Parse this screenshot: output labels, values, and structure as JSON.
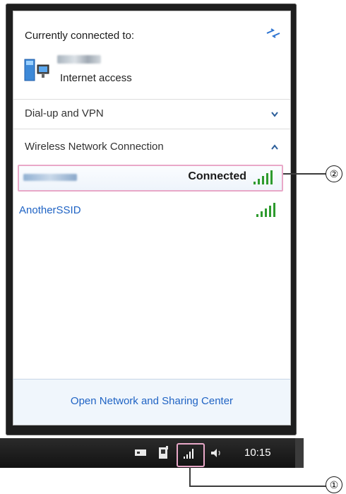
{
  "flyout": {
    "header": {
      "title": "Currently connected to:",
      "network_status": "Internet access"
    },
    "sections": [
      {
        "label": "Dial-up and VPN",
        "expanded": false
      },
      {
        "label": "Wireless Network Connection",
        "expanded": true
      }
    ],
    "networks": [
      {
        "status": "Connected",
        "signal_bars": 5
      },
      {
        "name": "AnotherSSID",
        "signal_bars": 5
      }
    ],
    "footer_link": "Open Network and Sharing Center"
  },
  "taskbar": {
    "time": "10:15",
    "tray_icons": [
      "action-center-icon",
      "power-icon",
      "wireless-signal-icon",
      "volume-icon"
    ]
  },
  "callouts": {
    "one": "①",
    "two": "②"
  },
  "colors": {
    "link_blue": "#1f63c4",
    "highlight_pink": "#e9a8c8",
    "signal_green": "#2e9b2e",
    "taskbar": "#1a1a1a"
  }
}
